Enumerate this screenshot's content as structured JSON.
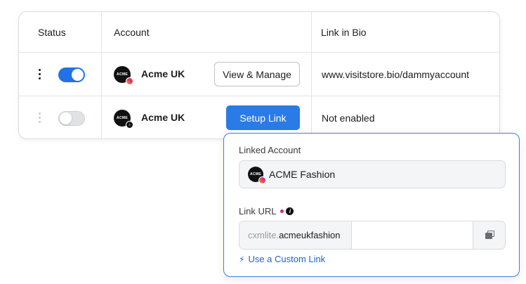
{
  "table": {
    "headers": {
      "status": "Status",
      "account": "Account",
      "link_in_bio": "Link in Bio"
    },
    "rows": [
      {
        "toggle_on": true,
        "avatar_text": "ACME",
        "platform_icon": "instagram-icon",
        "account_name": "Acme UK",
        "action_label": "View & Manage",
        "link_in_bio": "www.visitstore.bio/dammyaccount"
      },
      {
        "toggle_on": false,
        "avatar_text": "ACME",
        "platform_icon": "tiktok-icon",
        "account_name": "Acme UK",
        "action_label": "Setup Link",
        "link_in_bio": "Not enabled"
      }
    ]
  },
  "popover": {
    "linked_account_label": "Linked Account",
    "linked_account_avatar": "ACME",
    "linked_account_name": "ACME Fashion",
    "link_url_label": "Link URL",
    "url_prefix_muted": "cxmlite.",
    "url_prefix_handle": "acmeukfashion",
    "url_value": "",
    "custom_link_label": "Use a Custom Link"
  },
  "colors": {
    "primary": "#2b7be6",
    "toggle_on": "#2172e8",
    "link": "#1f63c8",
    "required": "#e0245e",
    "popover_border": "#3b7ee8"
  }
}
